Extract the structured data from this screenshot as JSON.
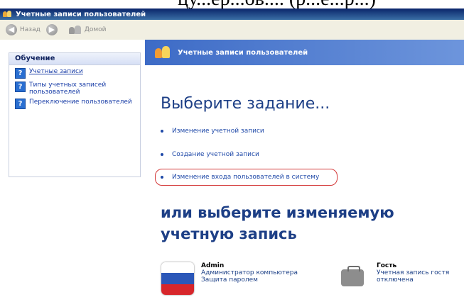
{
  "doc_fragment": "цу...ер...ов....  (р...е...р...)",
  "window": {
    "title": "Учетные записи пользователей"
  },
  "toolbar": {
    "back_label": "Назад",
    "home_label": "Домой"
  },
  "sidebar": {
    "learn_title": "Обучение",
    "items": [
      {
        "label": "Учетные записи",
        "icon": "help-icon"
      },
      {
        "label": "Типы учетных записей пользователей",
        "icon": "help-icon"
      },
      {
        "label": "Переключение пользователей",
        "icon": "help-icon"
      }
    ]
  },
  "content": {
    "header_title": "Учетные записи пользователей",
    "heading": "Выберите задание...",
    "tasks": [
      "Изменение учетной записи",
      "Создание учетной записи",
      "Изменение входа пользователей в систему"
    ],
    "heading2": "или выберите изменяемую учетную запись",
    "accounts": [
      {
        "name": "Admin",
        "line1": "Администратор компьютера",
        "line2": "Защита паролем",
        "icon": "flag-icon"
      },
      {
        "name": "Гость",
        "line1": "Учетная запись гостя",
        "line2": "отключена",
        "icon": "briefcase-icon"
      }
    ]
  },
  "colors": {
    "title_bar": "#0a246a",
    "header_blue": "#3d6bc6",
    "highlight_red": "#d43a3a"
  }
}
